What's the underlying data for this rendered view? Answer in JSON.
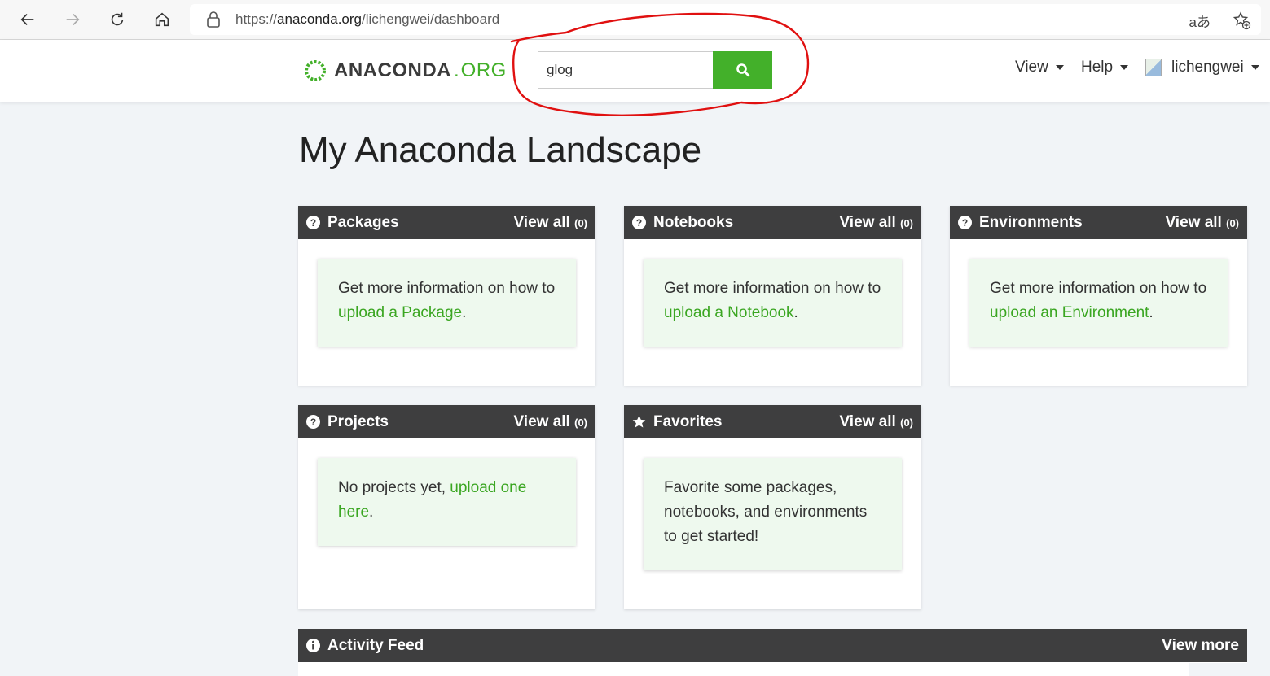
{
  "browser": {
    "url_prefix": "https://",
    "url_host": "anaconda.org",
    "url_path": "/lichengwei/dashboard",
    "translate_icon": "aあ"
  },
  "header": {
    "logo_main": "ANACONDA",
    "logo_dot": ".",
    "logo_org": "ORG",
    "search_value": "glog",
    "menu_view": "View",
    "menu_help": "Help",
    "menu_user": "lichengwei"
  },
  "page": {
    "title": "My Anaconda Landscape"
  },
  "panels": {
    "packages": {
      "title": "Packages",
      "view_label": "View all",
      "count": "(0)",
      "text1": "Get more information on how to ",
      "link": "upload a Package",
      "text2": "."
    },
    "notebooks": {
      "title": "Notebooks",
      "view_label": "View all",
      "count": "(0)",
      "text1": "Get more information on how to ",
      "link": "upload a Notebook",
      "text2": "."
    },
    "environments": {
      "title": "Environments",
      "view_label": "View all",
      "count": "(0)",
      "text1": "Get more information on how to ",
      "link": "upload an Environment",
      "text2": "."
    },
    "projects": {
      "title": "Projects",
      "view_label": "View all",
      "count": "(0)",
      "text1": "No projects yet, ",
      "link": "upload one here",
      "text2": "."
    },
    "favorites": {
      "title": "Favorites",
      "view_label": "View all",
      "count": "(0)",
      "text1": "Favorite some packages, notebooks, and environments to get started!"
    },
    "activity": {
      "title": "Activity Feed",
      "view_label": "View more"
    }
  },
  "colors": {
    "brand_green": "#43b02a",
    "panel_head": "#3e3e3f",
    "card_bg": "#eef9ee",
    "annotation_red": "#e01010"
  }
}
